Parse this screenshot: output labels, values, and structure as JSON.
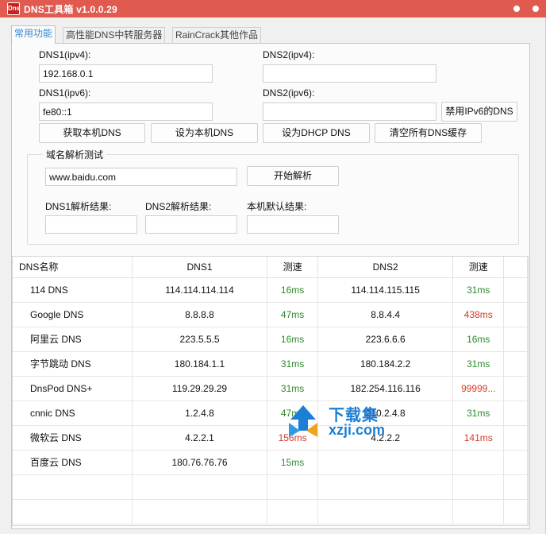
{
  "window": {
    "icon_text": "Dns",
    "title": "DNS工具箱 v1.0.0.29"
  },
  "tabs": [
    {
      "label": "常用功能"
    },
    {
      "label": "高性能DNS中转服务器"
    },
    {
      "label": "RainCrack其他作品"
    }
  ],
  "dns": {
    "dns1_v4_label": "DNS1(ipv4):",
    "dns1_v4_value": "192.168.0.1",
    "dns2_v4_label": "DNS2(ipv4):",
    "dns2_v4_value": "",
    "dns1_v6_label": "DNS1(ipv6):",
    "dns1_v6_value": "fe80::1",
    "dns2_v6_label": "DNS2(ipv6):",
    "dns2_v6_value": "",
    "disable_ipv6_label": "禁用IPv6的DNS"
  },
  "actions": {
    "get_local": "获取本机DNS",
    "set_local": "设为本机DNS",
    "set_dhcp": "设为DHCP DNS",
    "clear_cache": "清空所有DNS缓存"
  },
  "resolve": {
    "group_title": "域名解析测试",
    "domain_value": "www.baidu.com",
    "start_button": "开始解析",
    "dns1_result_label": "DNS1解析结果:",
    "dns2_result_label": "DNS2解析结果:",
    "local_result_label": "本机默认结果:",
    "dns1_result": "",
    "dns2_result": "",
    "local_result": ""
  },
  "table": {
    "headers": [
      "DNS名称",
      "DNS1",
      "测速",
      "DNS2",
      "测速"
    ],
    "rows": [
      {
        "name": "114 DNS",
        "dns1": "114.114.114.114",
        "speed1": "16ms",
        "speed1_status": "green",
        "dns2": "114.114.115.115",
        "speed2": "31ms",
        "speed2_status": "green"
      },
      {
        "name": "Google DNS",
        "dns1": "8.8.8.8",
        "speed1": "47ms",
        "speed1_status": "green",
        "dns2": "8.8.4.4",
        "speed2": "438ms",
        "speed2_status": "red"
      },
      {
        "name": "阿里云 DNS",
        "dns1": "223.5.5.5",
        "speed1": "16ms",
        "speed1_status": "green",
        "dns2": "223.6.6.6",
        "speed2": "16ms",
        "speed2_status": "green"
      },
      {
        "name": "字节跳动 DNS",
        "dns1": "180.184.1.1",
        "speed1": "31ms",
        "speed1_status": "green",
        "dns2": "180.184.2.2",
        "speed2": "31ms",
        "speed2_status": "green"
      },
      {
        "name": "DnsPod DNS+",
        "dns1": "119.29.29.29",
        "speed1": "31ms",
        "speed1_status": "green",
        "dns2": "182.254.116.116",
        "speed2": "99999...",
        "speed2_status": "red"
      },
      {
        "name": "cnnic DNS",
        "dns1": "1.2.4.8",
        "speed1": "47ms",
        "speed1_status": "green",
        "dns2": "210.2.4.8",
        "speed2": "31ms",
        "speed2_status": "green"
      },
      {
        "name": "微软云 DNS",
        "dns1": "4.2.2.1",
        "speed1": "156ms",
        "speed1_status": "red",
        "dns2": "4.2.2.2",
        "speed2": "141ms",
        "speed2_status": "red"
      },
      {
        "name": "百度云 DNS",
        "dns1": "180.76.76.76",
        "speed1": "15ms",
        "speed1_status": "green",
        "dns2": "",
        "speed2": "",
        "speed2_status": ""
      }
    ],
    "empty_rows": 2
  },
  "watermark": {
    "cn": "下载集",
    "en": "xzji.com"
  },
  "colors": {
    "titlebar": "#e05a50",
    "tab_active_text": "#3a86d0",
    "speed_good": "#2d8a2d",
    "speed_bad": "#d23b2b",
    "watermark": "#1b7fd6"
  }
}
